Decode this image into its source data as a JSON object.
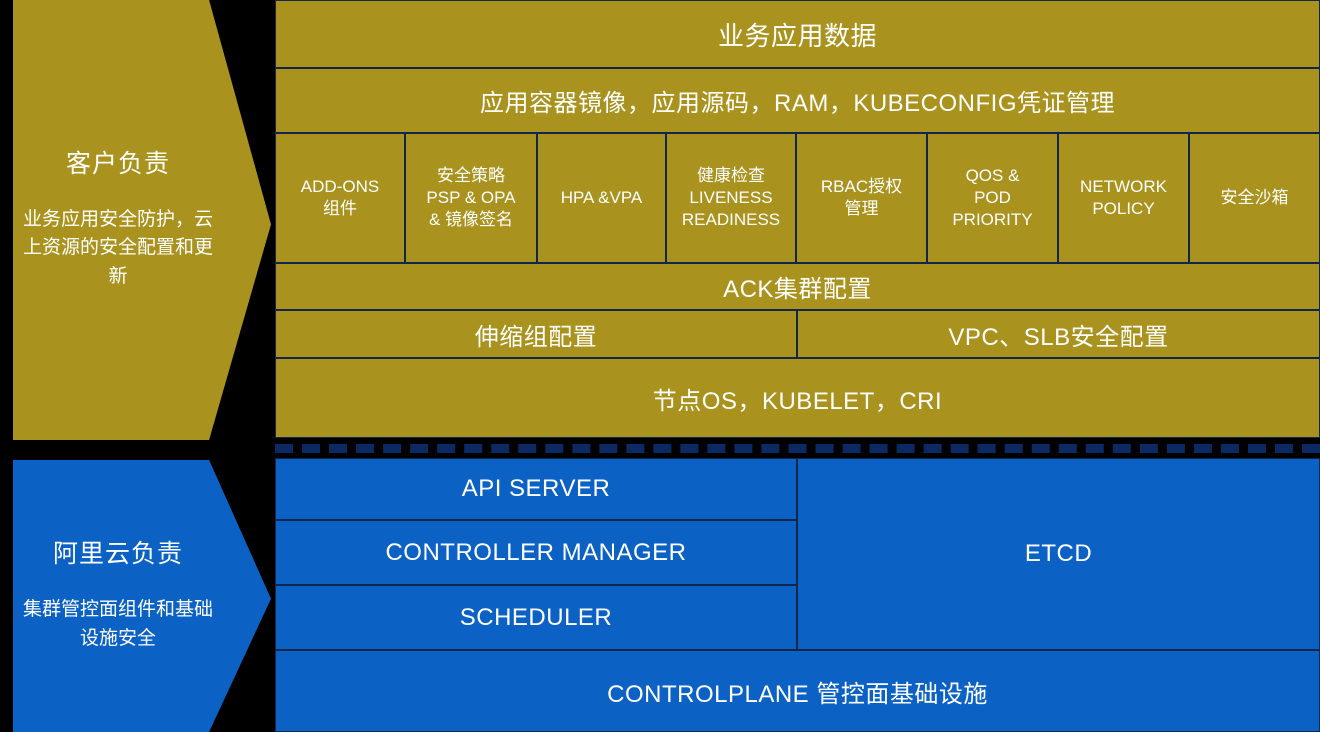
{
  "colors": {
    "customer_fill": "#A9921E",
    "aliyun_fill": "#0B62C4",
    "border": "#12264B",
    "divider": "#0B2A63",
    "background": "#000000",
    "text": "#FFFFFF"
  },
  "responsibility": {
    "customer": {
      "title": "客户负责",
      "subtitle": "业务应用安全防护，云上资源的安全配置和更新"
    },
    "aliyun": {
      "title": "阿里云负责",
      "subtitle": "集群管控面组件和基础设施安全"
    }
  },
  "customer_layers": {
    "row_app_data": "业务应用数据",
    "row_images": "应用容器镜像，应用源码，RAM，KUBECONFIG凭证管理",
    "row_components": [
      {
        "label": "ADD-ONS\n组件"
      },
      {
        "label": "安全策略\nPSP & OPA\n& 镜像签名"
      },
      {
        "label": "HPA &VPA"
      },
      {
        "label": "健康检查\nLIVENESS\nREADINESS"
      },
      {
        "label": "RBAC授权\n管理"
      },
      {
        "label": "QOS &\nPOD\nPRIORITY"
      },
      {
        "label": "NETWORK\nPOLICY"
      },
      {
        "label": "安全沙箱"
      }
    ],
    "row_ack": "ACK集群配置",
    "row_scaling": "伸缩组配置",
    "row_vpc": "VPC、SLB安全配置",
    "row_node_os": "节点OS，KUBELET，CRI"
  },
  "aliyun_layers": {
    "api_server": "API SERVER",
    "controller_manager": "CONTROLLER MANAGER",
    "scheduler": "SCHEDULER",
    "etcd": "ETCD",
    "controlplane": "CONTROLPLANE 管控面基础设施"
  }
}
